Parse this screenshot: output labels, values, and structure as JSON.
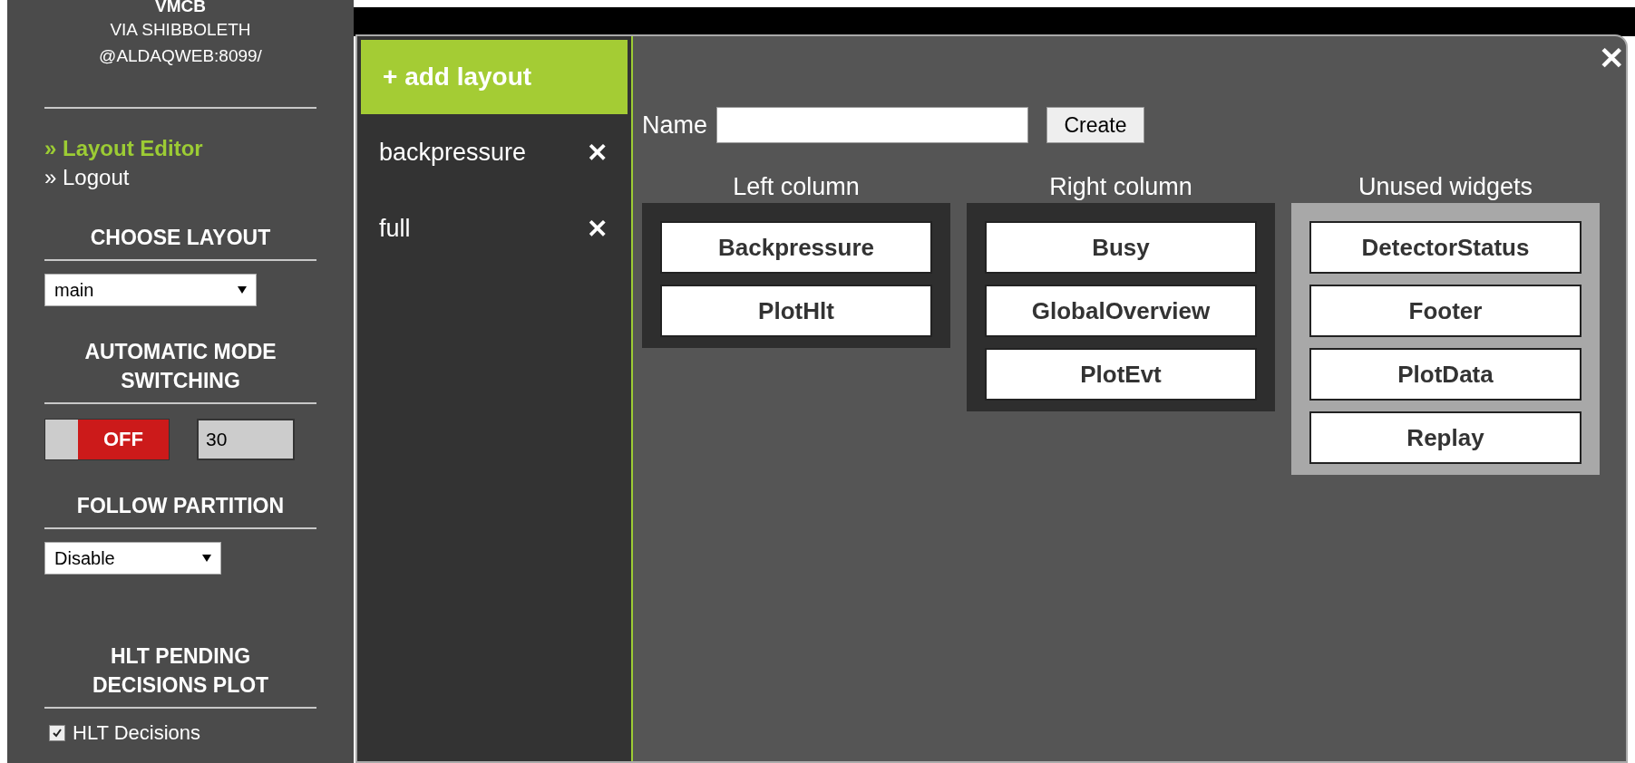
{
  "sidebar": {
    "user_lines": [
      "VMCB",
      "VIA SHIBBOLETH",
      "@ALDAQWEB:8099/"
    ],
    "links": [
      {
        "label": "» Layout Editor",
        "selected": true
      },
      {
        "label": "» Logout",
        "selected": false
      }
    ],
    "choose_layout": {
      "heading": "CHOOSE LAYOUT",
      "value": "main"
    },
    "auto_mode": {
      "heading": "AUTOMATIC MODE SWITCHING",
      "on": false,
      "toggle_label": "OFF",
      "interval": "30"
    },
    "follow_partition": {
      "heading": "FOLLOW PARTITION",
      "value": "Disable"
    },
    "hlt_plot": {
      "heading": "HLT PENDING DECISIONS PLOT",
      "checkbox": {
        "label": "HLT Decisions",
        "checked": true
      }
    }
  },
  "modal": {
    "close": "✕",
    "add_layout": "+ add layout",
    "layouts": [
      {
        "name": "backpressure",
        "delete": "✕"
      },
      {
        "name": "full",
        "delete": "✕"
      }
    ],
    "name_label": "Name",
    "create_button": "Create",
    "columns": [
      {
        "title": "Left column",
        "kind": "used",
        "widgets": [
          "Backpressure",
          "PlotHlt"
        ]
      },
      {
        "title": "Right column",
        "kind": "used",
        "widgets": [
          "Busy",
          "GlobalOverview",
          "PlotEvt"
        ]
      },
      {
        "title": "Unused widgets",
        "kind": "unused",
        "widgets": [
          "DetectorStatus",
          "Footer",
          "PlotData",
          "Replay"
        ]
      }
    ]
  }
}
